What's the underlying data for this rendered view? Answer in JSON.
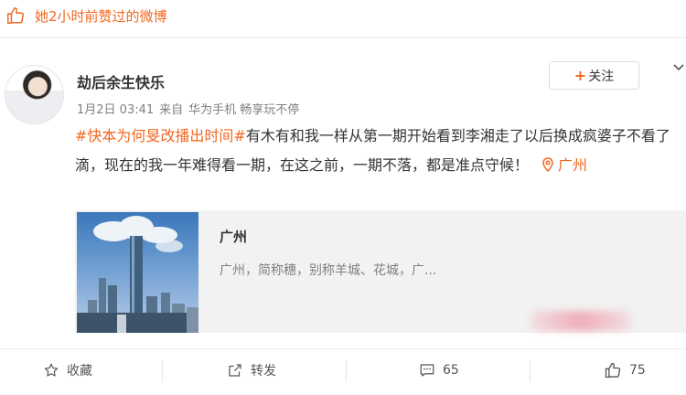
{
  "notice": {
    "text": "她2小时前赞过的微博",
    "icon": "thumbs-up-icon"
  },
  "post": {
    "username": "劫后余生快乐",
    "date": "1月2日 03:41",
    "source_prefix": "来自",
    "source": "华为手机 畅享玩不停",
    "follow_label": "关注",
    "hashtag": "#快本为何旻改播出时间#",
    "body": "有木有和我一样从第一期开始看到李湘走了以后换成疯婆子不看了滴，现在的我一年难得看一期，在这之前，一期不落，都是准点守候！",
    "location": "广州"
  },
  "card": {
    "title": "广州",
    "description": "广州，简称穗，别称羊城、花城，广..."
  },
  "actions": {
    "favorite_label": "收藏",
    "repost_label": "转发",
    "comment_count": "65",
    "like_count": "75"
  },
  "colors": {
    "accent": "#f2671f",
    "meta_gray": "#808080",
    "card_bg": "#f2f2f2"
  }
}
